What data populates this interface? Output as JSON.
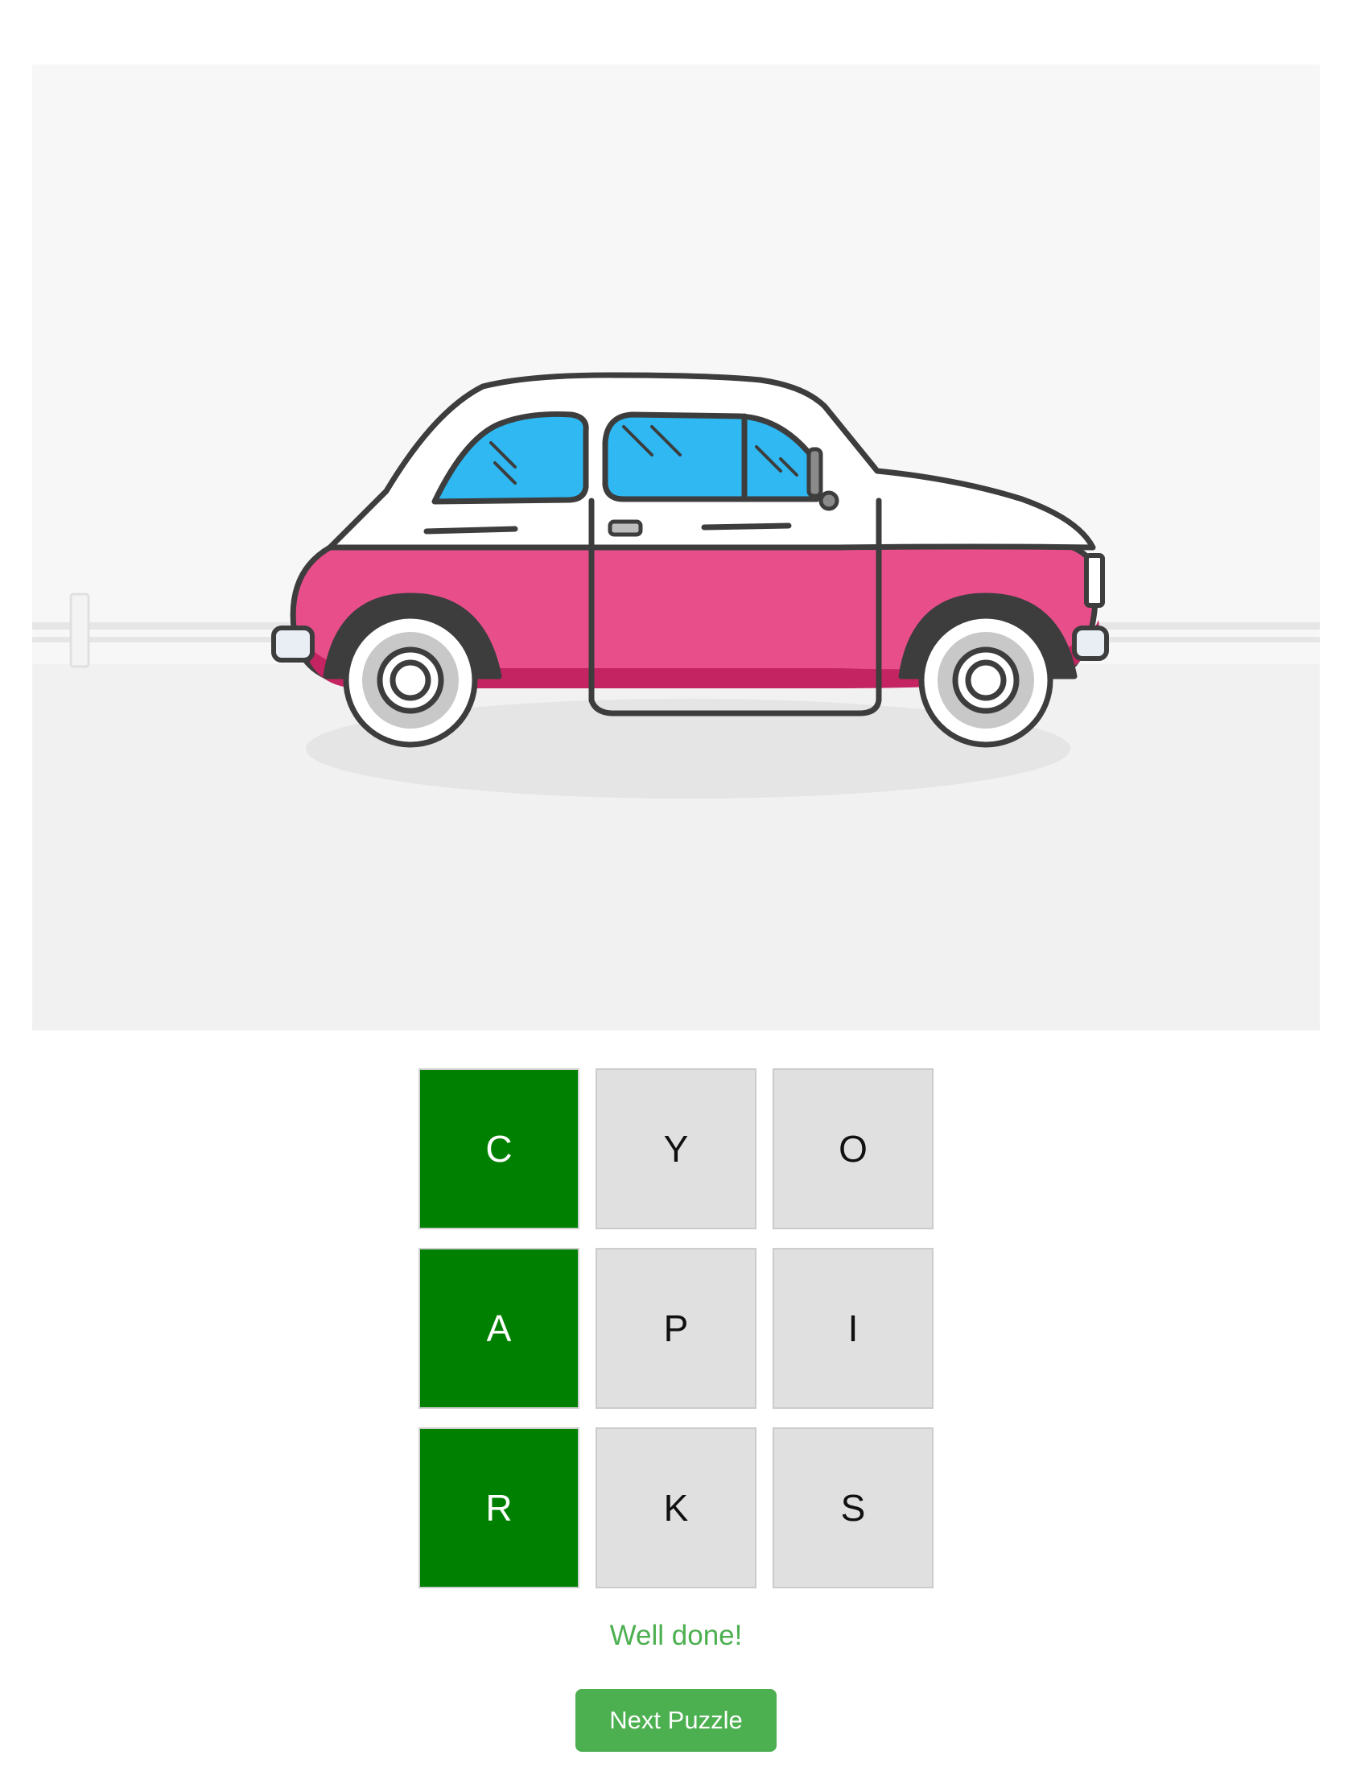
{
  "puzzle": {
    "illustration": "car-illustration",
    "tiles": [
      {
        "letter": "C",
        "state": "correct"
      },
      {
        "letter": "Y",
        "state": "unused"
      },
      {
        "letter": "O",
        "state": "unused"
      },
      {
        "letter": "A",
        "state": "correct"
      },
      {
        "letter": "P",
        "state": "unused"
      },
      {
        "letter": "I",
        "state": "unused"
      },
      {
        "letter": "R",
        "state": "correct"
      },
      {
        "letter": "K",
        "state": "unused"
      },
      {
        "letter": "S",
        "state": "unused"
      }
    ]
  },
  "status": {
    "message": "Well done!"
  },
  "actions": {
    "next_label": "Next Puzzle"
  },
  "colors": {
    "correct_tile": "#008000",
    "unused_tile": "#e0e0e0",
    "success": "#4caf50",
    "car_body": "#e84e8a",
    "car_window": "#2fb8f2"
  }
}
